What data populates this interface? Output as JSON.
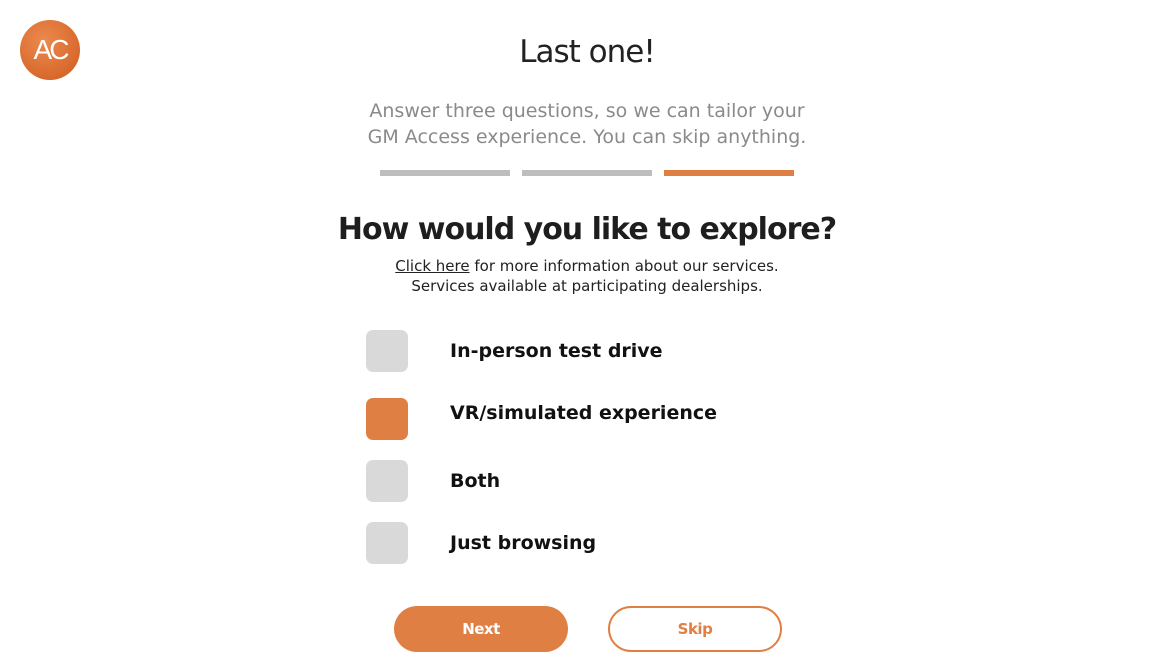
{
  "brand": {
    "logo_text": "AC",
    "accent_color": "#e07f43"
  },
  "header": {
    "title": "Last one!",
    "subtitle_line1": "Answer three questions, so we can tailor your",
    "subtitle_line2": "GM Access experience. You can skip anything."
  },
  "progress": {
    "total_steps": 3,
    "current_step": 3
  },
  "question": {
    "title": "How would you like to explore?",
    "link_text": "Click here",
    "info_after_link": " for more information about our services.",
    "info_line2": "Services available at participating dealerships."
  },
  "options": [
    {
      "label": "In-person test drive",
      "selected": false
    },
    {
      "label": "VR/simulated experience",
      "selected": true
    },
    {
      "label": "Both",
      "selected": false
    },
    {
      "label": "Just browsing",
      "selected": false
    }
  ],
  "actions": {
    "next_label": "Next",
    "skip_label": "Skip"
  }
}
